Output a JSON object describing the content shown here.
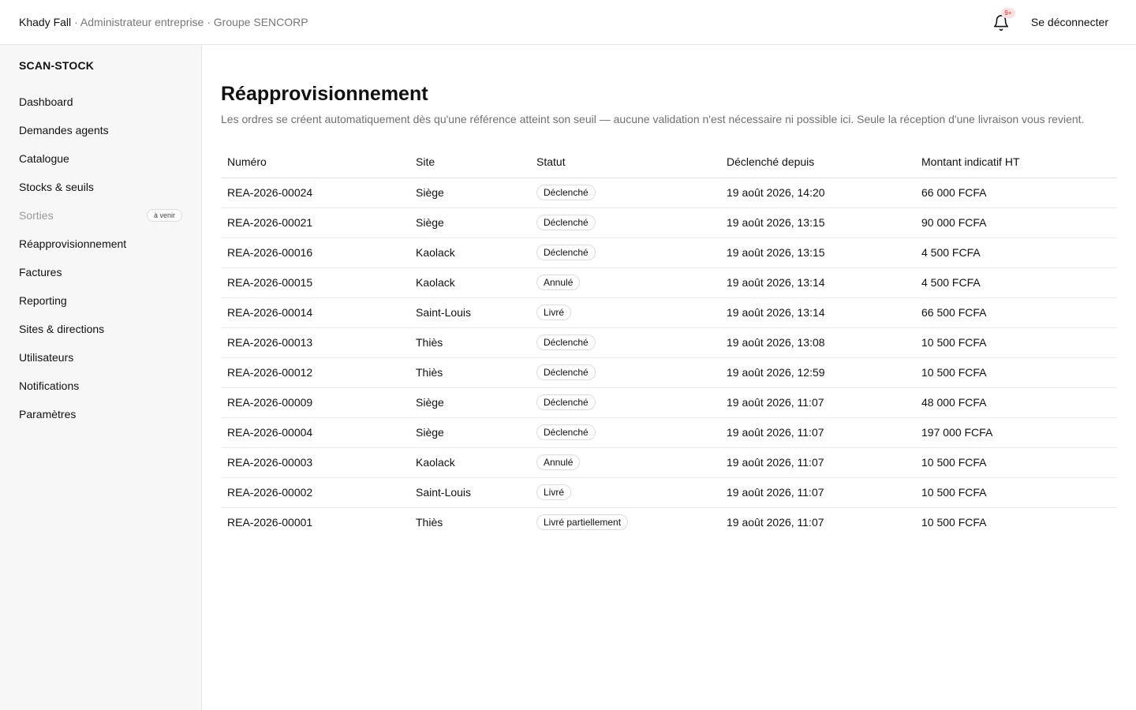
{
  "header": {
    "user_name": "Khady Fall",
    "user_meta": "· Administrateur entreprise · Groupe SENCORP",
    "notification_count": "9+",
    "logout_label": "Se déconnecter"
  },
  "sidebar": {
    "brand": "SCAN-STOCK",
    "items": [
      {
        "label": "Dashboard"
      },
      {
        "label": "Demandes agents"
      },
      {
        "label": "Catalogue"
      },
      {
        "label": "Stocks & seuils"
      },
      {
        "label": "Sorties",
        "badge": "à venir"
      },
      {
        "label": "Réapprovisionnement"
      },
      {
        "label": "Factures"
      },
      {
        "label": "Reporting"
      },
      {
        "label": "Sites & directions"
      },
      {
        "label": "Utilisateurs"
      },
      {
        "label": "Notifications"
      },
      {
        "label": "Paramètres"
      }
    ]
  },
  "page": {
    "title": "Réapprovisionnement",
    "description": "Les ordres se créent automatiquement dès qu'une référence atteint son seuil — aucune validation n'est nécessaire ni possible ici. Seule la réception d'une livraison vous revient."
  },
  "table": {
    "columns": [
      "Numéro",
      "Site",
      "Statut",
      "Déclenché depuis",
      "Montant indicatif HT"
    ],
    "rows": [
      [
        "REA-2026-00024",
        "Siège",
        "Déclenché",
        "19 août 2026, 14:20",
        "66 000 FCFA"
      ],
      [
        "REA-2026-00021",
        "Siège",
        "Déclenché",
        "19 août 2026, 13:15",
        "90 000 FCFA"
      ],
      [
        "REA-2026-00016",
        "Kaolack",
        "Déclenché",
        "19 août 2026, 13:15",
        "4 500 FCFA"
      ],
      [
        "REA-2026-00015",
        "Kaolack",
        "Annulé",
        "19 août 2026, 13:14",
        "4 500 FCFA"
      ],
      [
        "REA-2026-00014",
        "Saint-Louis",
        "Livré",
        "19 août 2026, 13:14",
        "66 500 FCFA"
      ],
      [
        "REA-2026-00013",
        "Thiès",
        "Déclenché",
        "19 août 2026, 13:08",
        "10 500 FCFA"
      ],
      [
        "REA-2026-00012",
        "Thiès",
        "Déclenché",
        "19 août 2026, 12:59",
        "10 500 FCFA"
      ],
      [
        "REA-2026-00009",
        "Siège",
        "Déclenché",
        "19 août 2026, 11:07",
        "48 000 FCFA"
      ],
      [
        "REA-2026-00004",
        "Siège",
        "Déclenché",
        "19 août 2026, 11:07",
        "197 000 FCFA"
      ],
      [
        "REA-2026-00003",
        "Kaolack",
        "Annulé",
        "19 août 2026, 11:07",
        "10 500 FCFA"
      ],
      [
        "REA-2026-00002",
        "Saint-Louis",
        "Livré",
        "19 août 2026, 11:07",
        "10 500 FCFA"
      ],
      [
        "REA-2026-00001",
        "Thiès",
        "Livré partiellement",
        "19 août 2026, 11:07",
        "10 500 FCFA"
      ]
    ]
  }
}
